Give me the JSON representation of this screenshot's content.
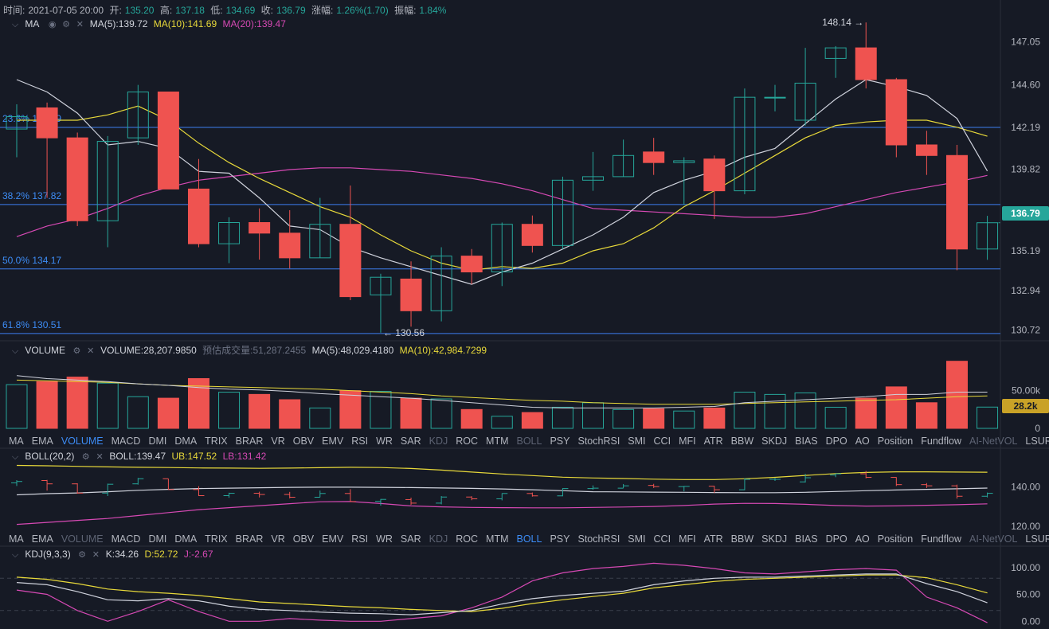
{
  "ohlc_header": {
    "time_label": "时间:",
    "time": "2021-07-05 20:00",
    "open_label": "开:",
    "open": "135.20",
    "high_label": "高:",
    "high": "137.18",
    "low_label": "低:",
    "low": "134.69",
    "close_label": "收:",
    "close": "136.79",
    "change_label": "涨幅:",
    "change": "1.26%(1.70)",
    "amplitude_label": "振幅:",
    "amplitude": "1.84%"
  },
  "ma_legend": {
    "name": "MA",
    "ma5": "MA(5):139.72",
    "ma10": "MA(10):141.69",
    "ma20": "MA(20):139.47"
  },
  "volume_legend": {
    "name": "VOLUME",
    "volume": "VOLUME:28,207.9850",
    "estimated": "预估成交量:51,287.2455",
    "ma5": "MA(5):48,029.4180",
    "ma10": "MA(10):42,984.7299"
  },
  "boll_legend": {
    "name": "BOLL(20,2)",
    "boll": "BOLL:139.47",
    "ub": "UB:147.52",
    "lb": "LB:131.42"
  },
  "kdj_legend": {
    "name": "KDJ(9,3,3)",
    "k": "K:34.26",
    "d": "D:52.72",
    "j": "J:-2.67"
  },
  "indicator_tabs": [
    "MA",
    "EMA",
    "VOLUME",
    "MACD",
    "DMI",
    "DMA",
    "TRIX",
    "BRAR",
    "VR",
    "OBV",
    "EMV",
    "RSI",
    "WR",
    "SAR",
    "KDJ",
    "ROC",
    "MTM",
    "BOLL",
    "PSY",
    "StochRSI",
    "SMI",
    "CCI",
    "MFI",
    "ATR",
    "BBW",
    "SKDJ",
    "BIAS",
    "DPO",
    "AO",
    "Position",
    "Fundflow",
    "AI-NetVOL",
    "LSUR"
  ],
  "tab_rows": [
    {
      "active": "VOLUME",
      "dim": [
        "KDJ",
        "BOLL",
        "AI-NetVOL"
      ]
    },
    {
      "active": "BOLL",
      "dim": [
        "VOLUME",
        "KDJ",
        "AI-NetVOL"
      ]
    }
  ],
  "price_tag": "136.79",
  "volume_tag": "28.2k",
  "colors": {
    "up": "#26a69a",
    "down": "#ef5350",
    "ma5": "#cfd2dc",
    "ma10": "#e8d93a",
    "ma20": "#d649b4",
    "fib": "#3d7ef0",
    "bg": "#161a25"
  },
  "chart_data": [
    {
      "type": "candlestick",
      "y_ticks": [
        147.05,
        144.6,
        142.19,
        139.82,
        137.48,
        135.19,
        132.94,
        130.72
      ],
      "high_marker": "148.14 →",
      "low_marker": "← 130.56",
      "fib_levels": [
        {
          "label": "23.6% 142.19",
          "value": 142.19
        },
        {
          "label": "38.2% 137.82",
          "value": 137.82
        },
        {
          "label": "50.0% 134.17",
          "value": 134.17
        },
        {
          "label": "61.8% 130.51",
          "value": 130.51
        }
      ],
      "candles": [
        {
          "o": 142.1,
          "h": 143.5,
          "l": 140.5,
          "c": 142.8
        },
        {
          "o": 143.3,
          "h": 143.6,
          "l": 138.2,
          "c": 141.6
        },
        {
          "o": 141.6,
          "h": 141.9,
          "l": 136.6,
          "c": 136.9
        },
        {
          "o": 136.9,
          "h": 141.7,
          "l": 135.4,
          "c": 141.4
        },
        {
          "o": 141.6,
          "h": 144.6,
          "l": 141.2,
          "c": 144.2
        },
        {
          "o": 144.2,
          "h": 144.2,
          "l": 138.7,
          "c": 138.7
        },
        {
          "o": 138.7,
          "h": 140.4,
          "l": 135.4,
          "c": 135.6
        },
        {
          "o": 135.6,
          "h": 137.1,
          "l": 134.5,
          "c": 136.8
        },
        {
          "o": 136.8,
          "h": 137.6,
          "l": 134.7,
          "c": 136.2
        },
        {
          "o": 136.2,
          "h": 137.5,
          "l": 134.2,
          "c": 134.8
        },
        {
          "o": 134.8,
          "h": 138.2,
          "l": 134.8,
          "c": 136.7
        },
        {
          "o": 136.7,
          "h": 138.9,
          "l": 132.4,
          "c": 132.6
        },
        {
          "o": 132.7,
          "h": 133.9,
          "l": 130.56,
          "c": 133.7
        },
        {
          "o": 133.6,
          "h": 134.6,
          "l": 130.9,
          "c": 131.8
        },
        {
          "o": 131.8,
          "h": 135.4,
          "l": 131.2,
          "c": 134.9
        },
        {
          "o": 134.9,
          "h": 135.3,
          "l": 133.3,
          "c": 134.0
        },
        {
          "o": 134.0,
          "h": 136.8,
          "l": 133.2,
          "c": 136.7
        },
        {
          "o": 136.7,
          "h": 137.2,
          "l": 135.1,
          "c": 135.5
        },
        {
          "o": 135.5,
          "h": 139.4,
          "l": 135.3,
          "c": 139.2
        },
        {
          "o": 139.2,
          "h": 140.8,
          "l": 138.6,
          "c": 139.4
        },
        {
          "o": 139.4,
          "h": 141.5,
          "l": 139.4,
          "c": 140.6
        },
        {
          "o": 140.8,
          "h": 141.6,
          "l": 139.5,
          "c": 140.2
        },
        {
          "o": 140.2,
          "h": 140.5,
          "l": 137.8,
          "c": 140.3
        },
        {
          "o": 140.4,
          "h": 140.6,
          "l": 137.0,
          "c": 138.6
        },
        {
          "o": 138.6,
          "h": 144.4,
          "l": 138.4,
          "c": 143.9
        },
        {
          "o": 143.9,
          "h": 144.6,
          "l": 143.1,
          "c": 143.9
        },
        {
          "o": 142.6,
          "h": 146.7,
          "l": 142.3,
          "c": 144.7
        },
        {
          "o": 146.1,
          "h": 146.8,
          "l": 145.0,
          "c": 146.7
        },
        {
          "o": 146.7,
          "h": 148.14,
          "l": 144.4,
          "c": 144.9
        },
        {
          "o": 144.9,
          "h": 145.0,
          "l": 140.5,
          "c": 141.2
        },
        {
          "o": 141.2,
          "h": 142.0,
          "l": 139.5,
          "c": 140.6
        },
        {
          "o": 140.6,
          "h": 141.2,
          "l": 134.1,
          "c": 135.3
        },
        {
          "o": 135.3,
          "h": 137.18,
          "l": 134.69,
          "c": 136.79
        }
      ],
      "ma5": [
        144.9,
        144.2,
        143.0,
        141.2,
        141.4,
        141.0,
        139.7,
        139.6,
        138.2,
        136.6,
        136.4,
        135.4,
        134.8,
        134.3,
        133.8,
        133.3,
        134.0,
        134.5,
        135.3,
        136.1,
        137.1,
        138.5,
        139.2,
        139.7,
        140.5,
        141.0,
        142.4,
        143.8,
        144.9,
        144.5,
        144.0,
        142.7,
        139.72
      ],
      "ma10": [
        142.6,
        142.6,
        142.6,
        142.9,
        143.4,
        142.6,
        141.3,
        140.2,
        139.3,
        138.5,
        137.7,
        137.1,
        136.1,
        135.2,
        134.5,
        134.1,
        134.3,
        134.2,
        134.5,
        135.2,
        135.6,
        136.5,
        137.7,
        138.6,
        139.6,
        140.6,
        141.6,
        142.3,
        142.5,
        142.6,
        142.6,
        142.2,
        141.69
      ],
      "ma20": [
        136.0,
        136.6,
        137.0,
        137.6,
        138.3,
        138.8,
        139.2,
        139.4,
        139.6,
        139.8,
        139.9,
        139.9,
        139.8,
        139.7,
        139.5,
        139.3,
        139.0,
        138.6,
        138.1,
        137.6,
        137.5,
        137.4,
        137.3,
        137.2,
        137.1,
        137.1,
        137.3,
        137.7,
        138.1,
        138.5,
        138.8,
        139.1,
        139.47
      ],
      "volume": {
        "values": [
          58,
          62,
          68,
          60,
          42,
          40,
          66,
          48,
          45,
          38,
          27,
          50,
          49,
          40,
          39,
          25,
          16,
          21,
          28,
          34,
          25,
          26,
          23,
          27,
          48,
          45,
          47,
          28,
          40,
          55,
          34,
          89,
          28.2
        ],
        "ma5": [
          70,
          66,
          64,
          62,
          59,
          57,
          54,
          52,
          51,
          49,
          46,
          44,
          42,
          40,
          37,
          34,
          31,
          28,
          27,
          27,
          27,
          27,
          28,
          29,
          34,
          36,
          38,
          40,
          42,
          45,
          45,
          48,
          48
        ],
        "ma10": [
          64,
          63,
          62,
          61,
          59,
          57,
          56,
          55,
          54,
          53,
          52,
          50,
          48,
          46,
          43,
          41,
          39,
          37,
          36,
          34,
          33,
          32,
          32,
          32,
          33,
          34,
          35,
          36,
          37,
          38,
          40,
          42,
          43
        ],
        "ticks": [
          "50.00k",
          "0"
        ]
      },
      "boll": {
        "ticks": [
          "140.00",
          "120.00"
        ],
        "mid": [
          136.0,
          136.6,
          137.0,
          137.6,
          138.3,
          138.8,
          139.2,
          139.4,
          139.6,
          139.8,
          139.9,
          139.9,
          139.8,
          139.7,
          139.5,
          139.3,
          139.0,
          138.6,
          138.1,
          137.6,
          137.5,
          137.4,
          137.3,
          137.2,
          137.1,
          137.1,
          137.3,
          137.7,
          138.1,
          138.5,
          138.8,
          139.1,
          139.47
        ],
        "ub": [
          151.0,
          150.8,
          150.5,
          150.2,
          150.0,
          149.9,
          149.7,
          149.6,
          149.5,
          149.6,
          149.8,
          150.0,
          149.9,
          149.4,
          148.6,
          147.6,
          146.6,
          145.8,
          145.0,
          144.6,
          144.3,
          144.0,
          143.8,
          143.8,
          144.2,
          144.9,
          145.9,
          146.8,
          147.4,
          147.7,
          147.7,
          147.6,
          147.52
        ],
        "lb": [
          121.0,
          122.0,
          123.0,
          124.0,
          125.5,
          127.0,
          128.5,
          129.5,
          130.5,
          131.5,
          132.5,
          132.6,
          131.6,
          130.4,
          129.9,
          129.6,
          129.5,
          129.4,
          129.4,
          129.6,
          129.8,
          130.1,
          130.6,
          131.3,
          131.7,
          131.6,
          131.2,
          130.6,
          130.3,
          130.4,
          130.7,
          131.0,
          131.42
        ]
      },
      "kdj": {
        "ticks": [
          "100.00",
          "50.00",
          "0.00"
        ],
        "k": [
          72,
          68,
          55,
          40,
          38,
          42,
          38,
          28,
          22,
          20,
          17,
          15,
          14,
          12,
          16,
          20,
          32,
          42,
          48,
          52,
          56,
          68,
          75,
          80,
          82,
          82,
          84,
          86,
          88,
          88,
          70,
          55,
          34.26
        ],
        "d": [
          82,
          78,
          70,
          60,
          55,
          52,
          48,
          42,
          36,
          33,
          30,
          27,
          25,
          22,
          20,
          18,
          24,
          33,
          40,
          46,
          52,
          62,
          68,
          74,
          78,
          80,
          82,
          84,
          86,
          86,
          81,
          68,
          52.72
        ],
        "j": [
          58,
          50,
          20,
          0,
          18,
          40,
          18,
          0,
          0,
          5,
          2,
          0,
          0,
          5,
          10,
          25,
          45,
          75,
          90,
          98,
          102,
          108,
          104,
          98,
          90,
          88,
          92,
          96,
          98,
          95,
          45,
          25,
          -2.67
        ]
      }
    }
  ]
}
